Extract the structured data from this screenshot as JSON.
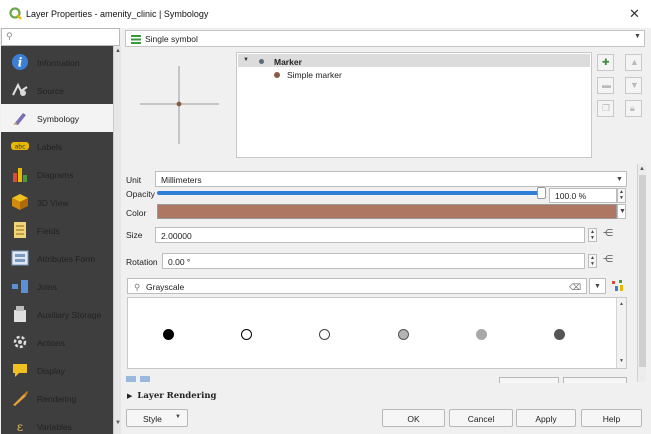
{
  "window": {
    "title": "Layer Properties - amenity_clinic | Symbology",
    "close_glyph": "✕"
  },
  "sidebar": {
    "search_placeholder": "",
    "items": [
      {
        "label": "Information",
        "icon": "information-icon"
      },
      {
        "label": "Source",
        "icon": "source-icon"
      },
      {
        "label": "Symbology",
        "icon": "symbology-icon",
        "active": true
      },
      {
        "label": "Labels",
        "icon": "labels-icon"
      },
      {
        "label": "Diagrams",
        "icon": "diagrams-icon"
      },
      {
        "label": "3D View",
        "icon": "3d-view-icon"
      },
      {
        "label": "Fields",
        "icon": "fields-icon"
      },
      {
        "label": "Attributes Form",
        "icon": "attributes-form-icon"
      },
      {
        "label": "Joins",
        "icon": "joins-icon"
      },
      {
        "label": "Auxiliary Storage",
        "icon": "auxiliary-storage-icon"
      },
      {
        "label": "Actions",
        "icon": "actions-icon"
      },
      {
        "label": "Display",
        "icon": "display-icon"
      },
      {
        "label": "Rendering",
        "icon": "rendering-icon"
      },
      {
        "label": "Variables",
        "icon": "variables-icon"
      }
    ]
  },
  "renderer": {
    "value": "Single symbol"
  },
  "tree": {
    "root_label": "Marker",
    "child_label": "Simple marker"
  },
  "unit": {
    "label": "Unit",
    "value": "Millimeters"
  },
  "opacity": {
    "label": "Opacity",
    "value": "100.0 %",
    "fraction": 1.0
  },
  "color": {
    "label": "Color",
    "hex": "#ad7761"
  },
  "size": {
    "label": "Size",
    "value": "2.00000"
  },
  "rotation": {
    "label": "Rotation",
    "value": "0.00 °"
  },
  "library": {
    "search_value": "Grayscale",
    "symbols": [
      {
        "name": "black-filled-circle",
        "fill": "#000000",
        "stroke": "#000000"
      },
      {
        "name": "white-circle",
        "fill": "#ffffff",
        "stroke": "#000000"
      },
      {
        "name": "white-circle-thin",
        "fill": "#ffffff",
        "stroke": "#444444"
      },
      {
        "name": "gray-circle-outlined",
        "fill": "#b4b4b4",
        "stroke": "#555555"
      },
      {
        "name": "light-gray-circle",
        "fill": "#a8a8a8",
        "stroke": "#a8a8a8"
      },
      {
        "name": "dark-gray-circle",
        "fill": "#555555",
        "stroke": "#555555"
      }
    ]
  },
  "layer_rendering": {
    "label": "Layer Rendering"
  },
  "buttons": {
    "style": "Style",
    "ok": "OK",
    "cancel": "Cancel",
    "apply": "Apply",
    "help": "Help"
  }
}
